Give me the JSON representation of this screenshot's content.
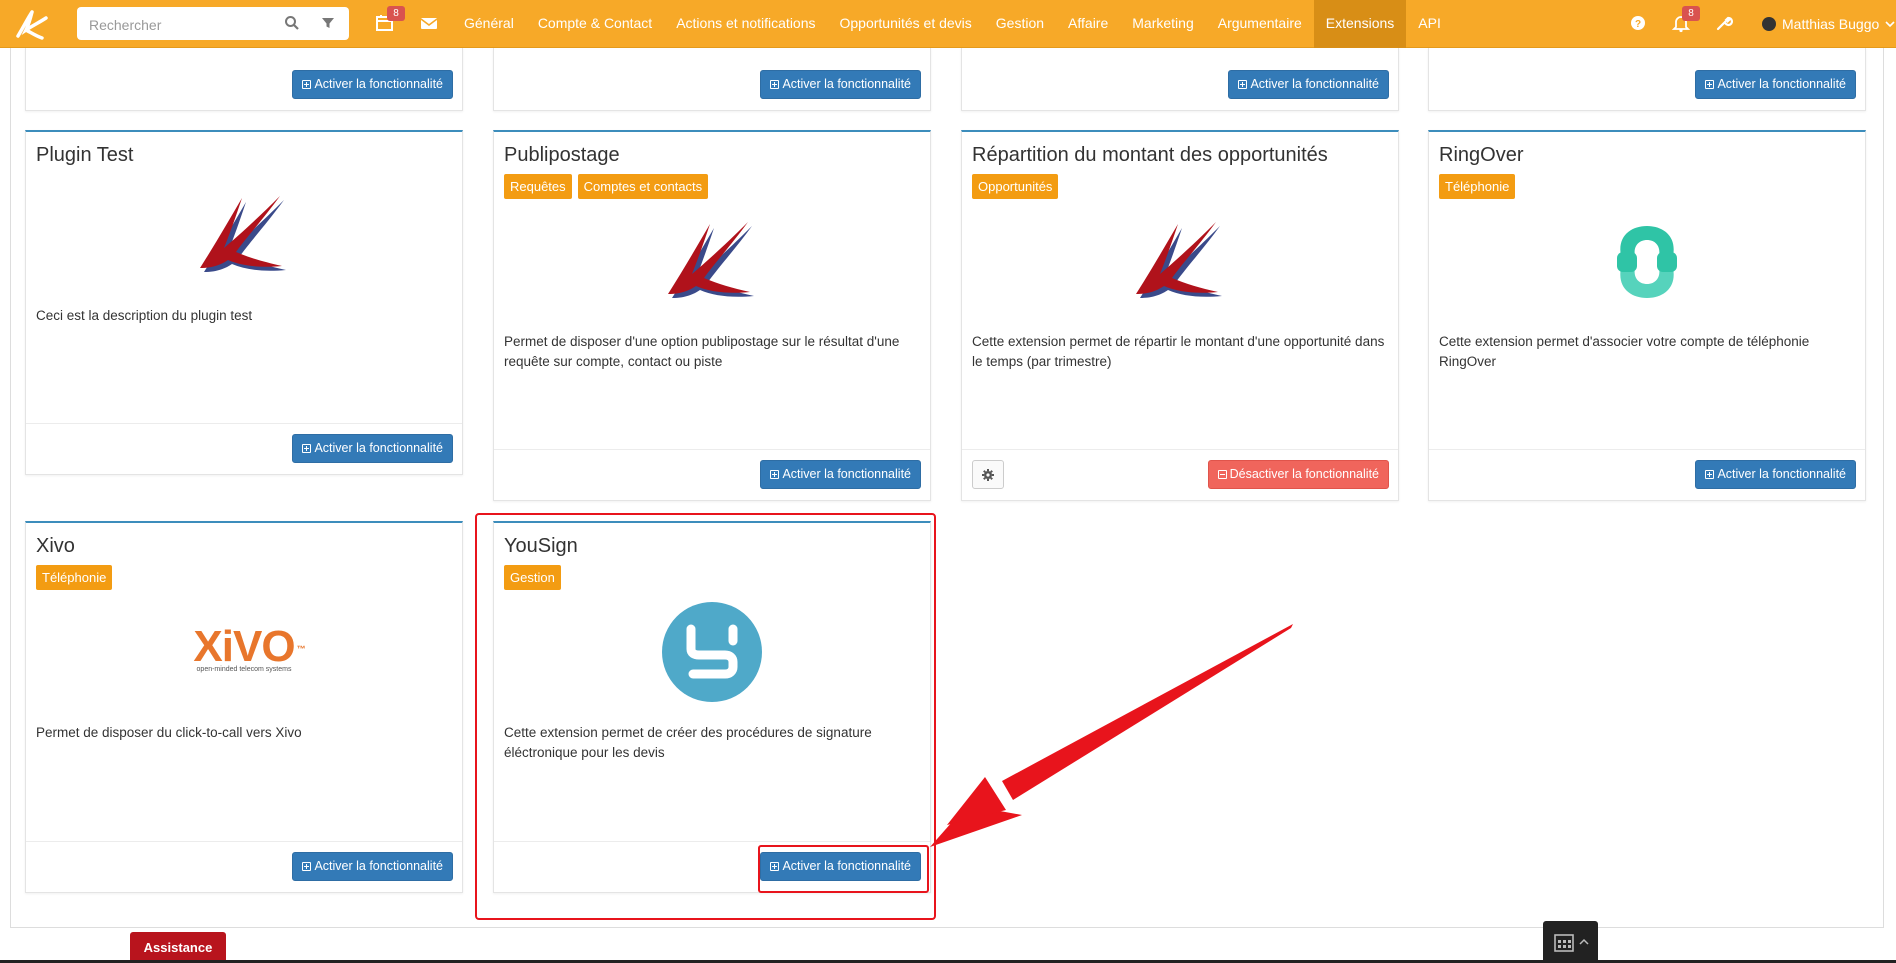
{
  "navbar": {
    "search_placeholder": "Rechercher",
    "calendar_badge": "8",
    "notifications_badge": "8",
    "menu": [
      "Général",
      "Compte & Contact",
      "Actions et notifications",
      "Opportunités et devis",
      "Gestion",
      "Affaire",
      "Marketing",
      "Argumentaire",
      "Extensions",
      "API"
    ],
    "active_menu": "Extensions",
    "user_name": "Matthias Buggo"
  },
  "buttons": {
    "activate": "Activer la fonctionnalité",
    "deactivate": "Désactiver la fonctionnalité"
  },
  "cards": [
    {
      "title": "Plugin Test",
      "tags": [],
      "logo": "k-logo",
      "description": "Ceci est la description du plugin test",
      "status": "inactive"
    },
    {
      "title": "Publipostage",
      "tags": [
        "Requêtes",
        "Comptes et contacts"
      ],
      "logo": "k-logo",
      "description": "Permet de disposer d'une option publipostage sur le résultat d'une requête sur compte, contact ou piste",
      "status": "inactive"
    },
    {
      "title": "Répartition du montant des opportunités",
      "tags": [
        "Opportunités"
      ],
      "logo": "k-logo",
      "description": "Cette extension permet de répartir le montant d'une opportunité dans le temps (par trimestre)",
      "status": "active"
    },
    {
      "title": "RingOver",
      "tags": [
        "Téléphonie"
      ],
      "logo": "ringover-logo",
      "description": "Cette extension permet d'associer votre compte de téléphonie RingOver",
      "status": "inactive"
    },
    {
      "title": "Xivo",
      "tags": [
        "Téléphonie"
      ],
      "logo": "xivo-logo",
      "logo_text": "XiVO",
      "logo_tm": "™",
      "logo_tagline": "open-minded telecom systems",
      "description": "Permet de disposer du click-to-call vers Xivo",
      "status": "inactive"
    },
    {
      "title": "YouSign",
      "tags": [
        "Gestion"
      ],
      "logo": "yousign-logo",
      "description": "Cette extension permet de créer des procédures de signature éléctronique pour les devis",
      "status": "inactive"
    }
  ],
  "assistance_label": "Assistance",
  "colors": {
    "navbar": "#f7a928",
    "primary_button": "#337ab7",
    "danger_button": "#f0655c",
    "tag": "#f39c12",
    "annotation": "#e8141c"
  }
}
